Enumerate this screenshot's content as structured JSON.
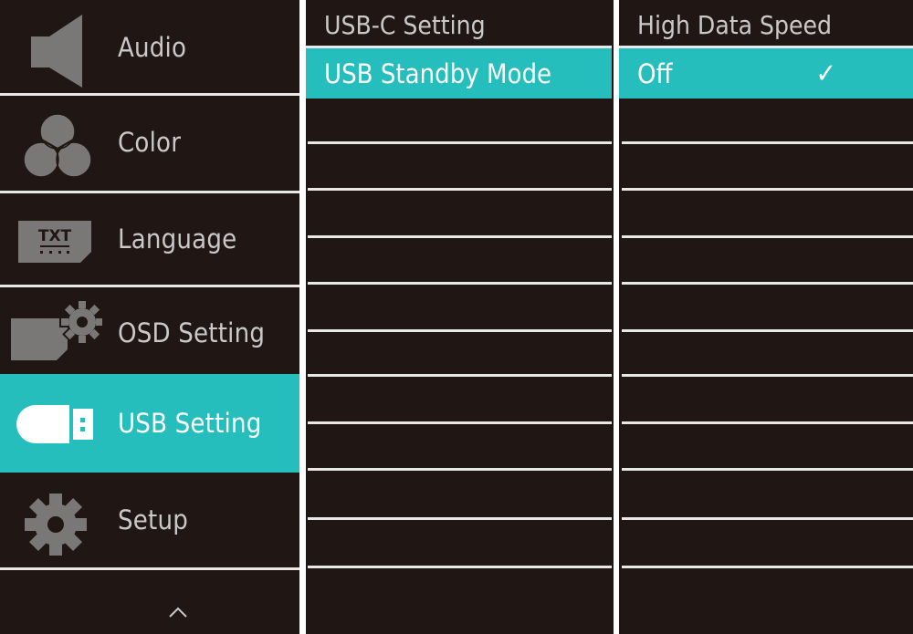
{
  "menu": {
    "items": [
      {
        "label": "Audio",
        "icon": "speaker-icon"
      },
      {
        "label": "Color",
        "icon": "color-circles-icon"
      },
      {
        "label": "Language",
        "icon": "txt-language-icon"
      },
      {
        "label": "OSD Setting",
        "icon": "osd-gear-icon"
      },
      {
        "label": "USB Setting",
        "icon": "usb-icon",
        "active": true
      },
      {
        "label": "Setup",
        "icon": "gear-icon"
      }
    ],
    "scroll_indicator": "chevron-up-icon",
    "language_icon_text": "TXT"
  },
  "submenu": {
    "header": "USB-C Setting",
    "selected": "USB Standby Mode"
  },
  "options": {
    "header": "High Data Speed",
    "selected": "Off",
    "check_mark": "✓"
  },
  "colors": {
    "background": "#201714",
    "accent": "#26bdbd",
    "text": "#c9c9c9",
    "divider": "#e8e8e8"
  }
}
